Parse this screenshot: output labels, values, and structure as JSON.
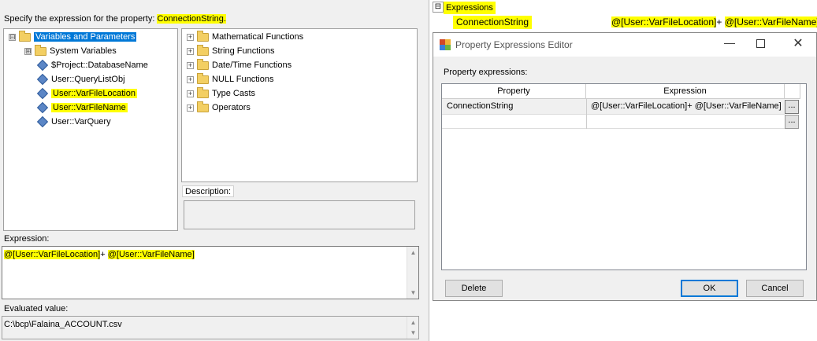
{
  "left": {
    "specify_label": "Specify the expression for the property:",
    "property_name": "ConnectionString.",
    "var_tree": [
      {
        "label": "Variables and Parameters",
        "kind": "folder",
        "expander": "⊟",
        "selected": true,
        "highlight": false
      },
      {
        "label": "System Variables",
        "kind": "folder",
        "expander": "⊞",
        "selected": false,
        "highlight": false
      },
      {
        "label": "$Project::DatabaseName",
        "kind": "var",
        "selected": false,
        "highlight": false
      },
      {
        "label": "User::QueryListObj",
        "kind": "var",
        "selected": false,
        "highlight": false
      },
      {
        "label": "User::VarFileLocation",
        "kind": "var",
        "selected": false,
        "highlight": true
      },
      {
        "label": "User::VarFileName",
        "kind": "var",
        "selected": false,
        "highlight": true
      },
      {
        "label": "User::VarQuery",
        "kind": "var",
        "selected": false,
        "highlight": false
      }
    ],
    "func_tree": [
      {
        "label": "Mathematical Functions"
      },
      {
        "label": "String Functions"
      },
      {
        "label": "Date/Time Functions"
      },
      {
        "label": "NULL Functions"
      },
      {
        "label": "Type Casts"
      },
      {
        "label": "Operators"
      }
    ],
    "description_label": "Description:",
    "expression_label": "Expression:",
    "expression_part1": "@[User::VarFileLocation]",
    "expression_plus": "+ ",
    "expression_part2": "@[User::VarFileName]",
    "evaluated_label": "Evaluated value:",
    "evaluated_value": "C:\\bcp\\Falaina_ACCOUNT.csv"
  },
  "props": {
    "expander": "⊟",
    "category": "Expressions",
    "row_name": "ConnectionString",
    "row_value_part1": "@[User::VarFileLocation]",
    "row_value_plus": "+ ",
    "row_value_part2": "@[User::VarFileName]"
  },
  "dialog": {
    "title": "Property Expressions Editor",
    "label": "Property expressions:",
    "col_property": "Property",
    "col_expression": "Expression",
    "rows": [
      {
        "property": "ConnectionString",
        "expression": "@[User::VarFileLocation]+ @[User::VarFileName]"
      },
      {
        "property": "",
        "expression": ""
      }
    ],
    "ellipsis": "...",
    "delete_label": "Delete",
    "ok_label": "OK",
    "cancel_label": "Cancel"
  }
}
